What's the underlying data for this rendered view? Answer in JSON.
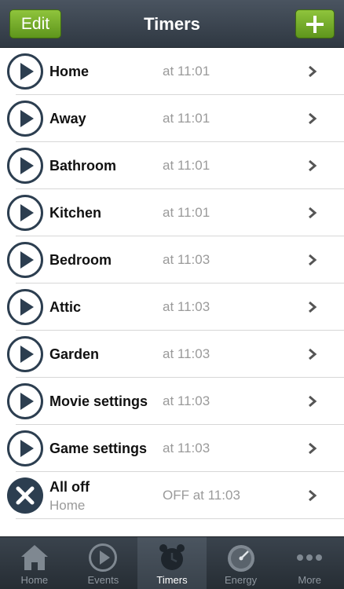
{
  "navbar": {
    "title": "Timers",
    "edit_label": "Edit",
    "add_icon": "plus-icon"
  },
  "colors": {
    "accent_green": "#6aa322",
    "icon_dark": "#2c3e50",
    "navbar": "#3a434d"
  },
  "timers": [
    {
      "name": "Home",
      "time": "at 11:01",
      "icon": "play-icon"
    },
    {
      "name": "Away",
      "time": "at 11:01",
      "icon": "play-icon"
    },
    {
      "name": "Bathroom",
      "time": "at 11:01",
      "icon": "play-icon"
    },
    {
      "name": "Kitchen",
      "time": "at 11:01",
      "icon": "play-icon"
    },
    {
      "name": "Bedroom",
      "time": "at 11:03",
      "icon": "play-icon"
    },
    {
      "name": "Attic",
      "time": "at 11:03",
      "icon": "play-icon"
    },
    {
      "name": "Garden",
      "time": "at 11:03",
      "icon": "play-icon"
    },
    {
      "name": "Movie settings",
      "time": "at 11:03",
      "icon": "play-icon"
    },
    {
      "name": "Game settings",
      "time": "at 11:03",
      "icon": "play-icon"
    },
    {
      "name": "All off",
      "subtitle": "Home",
      "time": "OFF at 11:03",
      "icon": "close-icon"
    }
  ],
  "tabs": [
    {
      "label": "Home",
      "icon": "house-icon",
      "active": false
    },
    {
      "label": "Events",
      "icon": "play-circle-icon",
      "active": false
    },
    {
      "label": "Timers",
      "icon": "alarm-clock-icon",
      "active": true
    },
    {
      "label": "Energy",
      "icon": "gauge-icon",
      "active": false
    },
    {
      "label": "More",
      "icon": "more-dots-icon",
      "active": false
    }
  ]
}
